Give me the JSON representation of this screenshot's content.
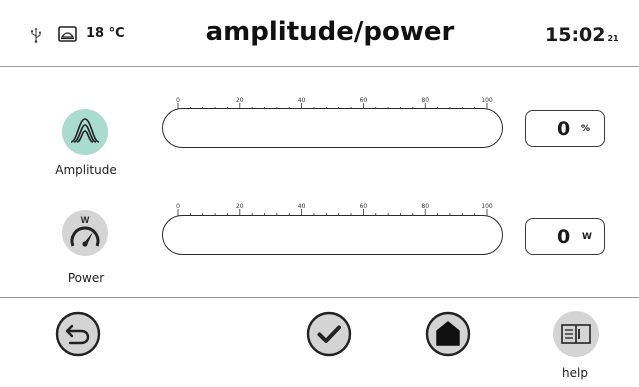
{
  "header": {
    "usb_icon": "usb-icon",
    "thermometer_icon": "thermometer-icon",
    "temperature": "18 °C",
    "title": "amplitude/power",
    "time": "15:02",
    "seconds": "21"
  },
  "params": [
    {
      "id": "amplitude",
      "label": "Amplitude",
      "icon": "amplitude-waveform-icon",
      "icon_color": "#a9dccf",
      "value": "0",
      "unit": "%",
      "scale": [
        "0",
        "20",
        "40",
        "60",
        "80",
        "100"
      ]
    },
    {
      "id": "power",
      "label": "Power",
      "icon": "power-gauge-icon",
      "icon_color": "#d4d4d4",
      "icon_text": "W",
      "value": "0",
      "unit": "W",
      "scale": [
        "0",
        "20",
        "40",
        "60",
        "80",
        "100"
      ]
    }
  ],
  "footer": {
    "back_icon": "back-arrow-icon",
    "confirm_icon": "checkmark-icon",
    "home_icon": "home-icon",
    "help_icon": "book-icon",
    "help_label": "help"
  },
  "colors": {
    "accent": "#a9dccf",
    "button_bg": "#d4d4d4",
    "outline": "#2b2b2b"
  }
}
